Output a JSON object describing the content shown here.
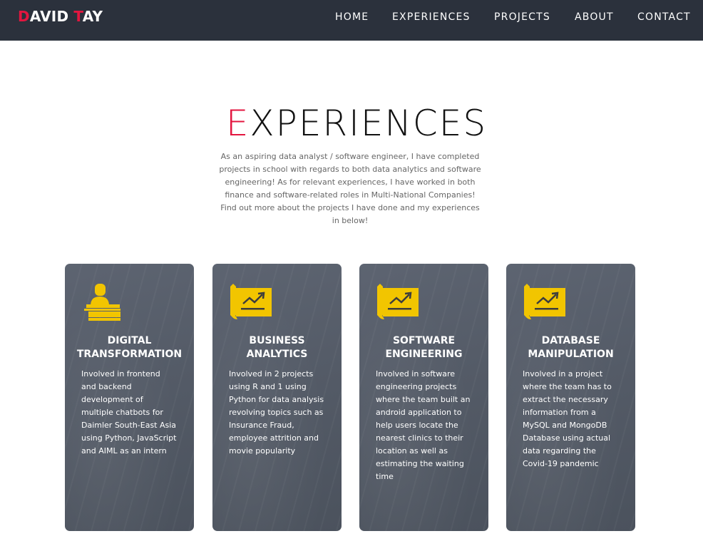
{
  "brand": {
    "initial_1": "D",
    "rest_1": "AVID ",
    "initial_2": "T",
    "rest_2": "AY"
  },
  "nav": {
    "items": [
      {
        "label": "HOME"
      },
      {
        "label": "EXPERIENCES"
      },
      {
        "label": "PROJECTS"
      },
      {
        "label": "ABOUT"
      },
      {
        "label": "CONTACT"
      }
    ]
  },
  "section": {
    "title_first": "E",
    "title_rest": "XPERIENCES",
    "intro_lines": [
      "As an aspiring data analyst / software engineer, I have completed",
      "projects in school with regards to both data analytics and software",
      "engineering! As for relevant experiences, I have worked in both",
      "finance and software-related roles in Multi-National Companies!",
      "Find out more about the projects I have done and my experiences",
      "in below!"
    ]
  },
  "cards": [
    {
      "icon": "person-on-stand-icon",
      "title_lines": [
        "DIGITAL",
        "TRANSFORMATION"
      ],
      "desc_lines": [
        "Involved in frontend",
        "and backend",
        "development of",
        "multiple chatbots for",
        "Daimler South-East Asia",
        "using Python, JavaScript",
        "and AIML as an intern"
      ]
    },
    {
      "icon": "chart-banner-icon",
      "title_lines": [
        "BUSINESS",
        "ANALYTICS"
      ],
      "desc_lines": [
        "Involved in 2 projects",
        "using R and 1 using",
        "Python for data analysis",
        "revolving topics such as",
        "Insurance Fraud,",
        "employee attrition and",
        "movie popularity"
      ]
    },
    {
      "icon": "chart-banner-icon",
      "title_lines": [
        "SOFTWARE",
        "ENGINEERING"
      ],
      "desc_lines": [
        "Involved in software",
        "engineering projects",
        "where the team built an",
        "android application to",
        "help users locate the",
        "nearest clinics to their",
        "location as well as",
        "estimating the waiting",
        "time"
      ]
    },
    {
      "icon": "chart-banner-icon",
      "title_lines": [
        "DATABASE",
        "MANIPULATION"
      ],
      "desc_lines": [
        "Involved in a project",
        "where the team has to",
        "extract the necessary",
        "information from a",
        "MySQL and MongoDB",
        "Database using actual",
        "data regarding the",
        "Covid-19 pandemic"
      ]
    }
  ],
  "colors": {
    "accent": "#e3163f",
    "navbar": "#2b313c",
    "icon": "#f2c500",
    "card": "#555c68"
  }
}
